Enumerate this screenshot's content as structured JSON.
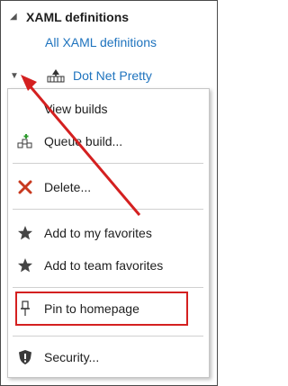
{
  "tree": {
    "header": {
      "title": "XAML definitions"
    },
    "all_link": "All XAML definitions",
    "item": {
      "label": "Dot Net Pretty"
    }
  },
  "menu": {
    "items": [
      {
        "label": "View builds",
        "icon": "none"
      },
      {
        "label": "Queue build...",
        "icon": "queue-build-icon"
      },
      {
        "label": "Delete...",
        "icon": "delete-x-icon"
      },
      {
        "label": "Add to my favorites",
        "icon": "star-icon"
      },
      {
        "label": "Add to team favorites",
        "icon": "star-icon"
      },
      {
        "label": "Pin to homepage",
        "icon": "pin-icon"
      },
      {
        "label": "Security...",
        "icon": "shield-icon"
      }
    ]
  },
  "colors": {
    "link": "#1e73be",
    "text": "#1e1e1e",
    "annotation_red": "#d42020",
    "delete_red": "#c8391f"
  }
}
